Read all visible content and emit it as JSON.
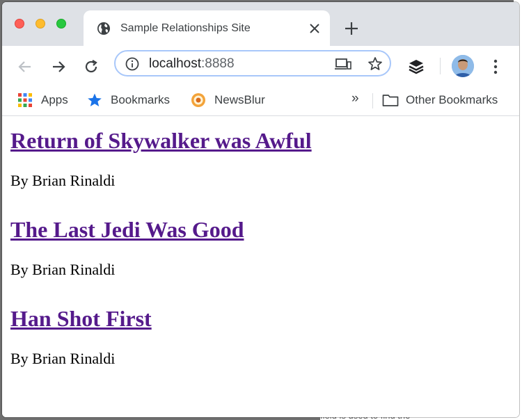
{
  "browser": {
    "tab_title": "Sample Relationships Site",
    "tab_favicon": "globe-icon",
    "url_host": "localhost",
    "url_port": ":8888"
  },
  "bookmarks": {
    "apps": "Apps",
    "bookmarks": "Bookmarks",
    "newsblur": "NewsBlur",
    "overflow": "»",
    "other": "Other Bookmarks"
  },
  "posts": [
    {
      "title": "Return of Skywalker was Awful",
      "byline": "By Brian Rinaldi"
    },
    {
      "title": "The Last Jedi Was Good",
      "byline": "By Brian Rinaldi"
    },
    {
      "title": "Han Shot First",
      "byline": "By Brian Rinaldi"
    }
  ],
  "backdrop": {
    "partial_text": "field is used to find the"
  },
  "colors": {
    "link_visited": "#551a8b",
    "tabstrip": "#dee1e6",
    "omnibox_focus": "#a8c7fa"
  }
}
